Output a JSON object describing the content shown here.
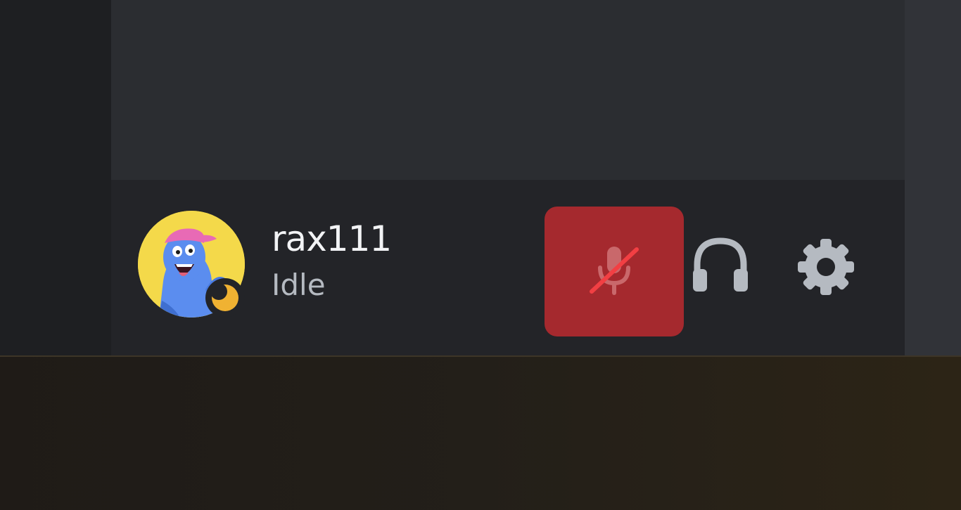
{
  "user": {
    "username": "rax111",
    "status": "Idle"
  },
  "controls": {
    "mute": {
      "icon": "microphone-muted-icon",
      "active": true,
      "active_color": "#a5292e"
    },
    "deafen": {
      "icon": "headphones-icon"
    },
    "settings": {
      "icon": "gear-icon"
    }
  },
  "colors": {
    "status_idle": "#f0b232",
    "icon_default": "#b5bac1",
    "muted_slash": "#f23f43"
  }
}
